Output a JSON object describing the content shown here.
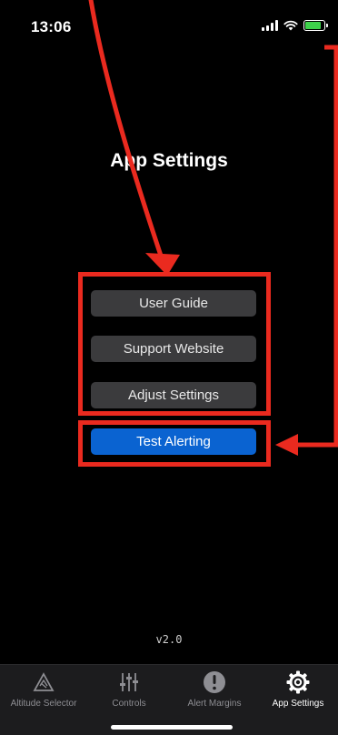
{
  "status_bar": {
    "time": "13:06"
  },
  "screen": {
    "title": "App Settings"
  },
  "buttons": {
    "user_guide": "User Guide",
    "support_website": "Support Website",
    "adjust_settings": "Adjust Settings",
    "test_alerting": "Test Alerting"
  },
  "version": "v2.0",
  "tab_bar": {
    "tabs": [
      {
        "label": "Altitude Selector",
        "icon": "altitude-selector-icon"
      },
      {
        "label": "Controls",
        "icon": "sliders-icon"
      },
      {
        "label": "Alert Margins",
        "icon": "alert-circle-icon"
      },
      {
        "label": "App Settings",
        "icon": "gear-icon",
        "active": true
      }
    ]
  },
  "colors": {
    "background": "#000000",
    "button": "#3b3b3d",
    "primary_button": "#0a63d1",
    "annotation": "#ea2a1f",
    "battery": "#3ed14b"
  }
}
